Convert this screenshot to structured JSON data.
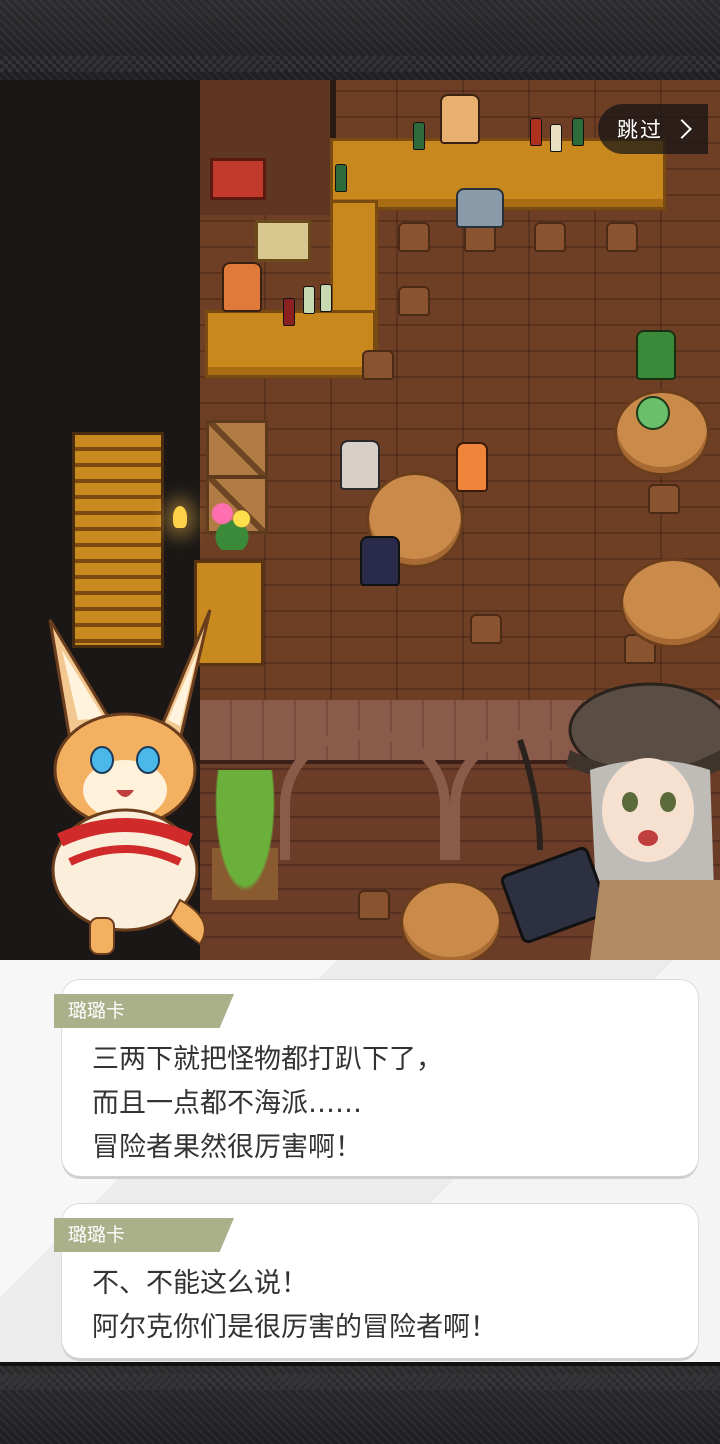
{
  "skip_button": {
    "label": "跳过"
  },
  "dialogues": [
    {
      "speaker": "璐璐卡",
      "lines": [
        "三两下就把怪物都打趴下了，",
        "而且一点都不海派……",
        "冒险者果然很厉害啊！"
      ]
    },
    {
      "speaker": "璐璐卡",
      "lines": [
        "不、不能这么说！",
        "阿尔克你们是很厉害的冒险者啊！"
      ]
    }
  ],
  "colors": {
    "nametag": "#a9b08a",
    "bubble": "#ffffff",
    "dialogue_text": "#333333"
  },
  "icons": {
    "skip": "chevron-right-icon"
  }
}
